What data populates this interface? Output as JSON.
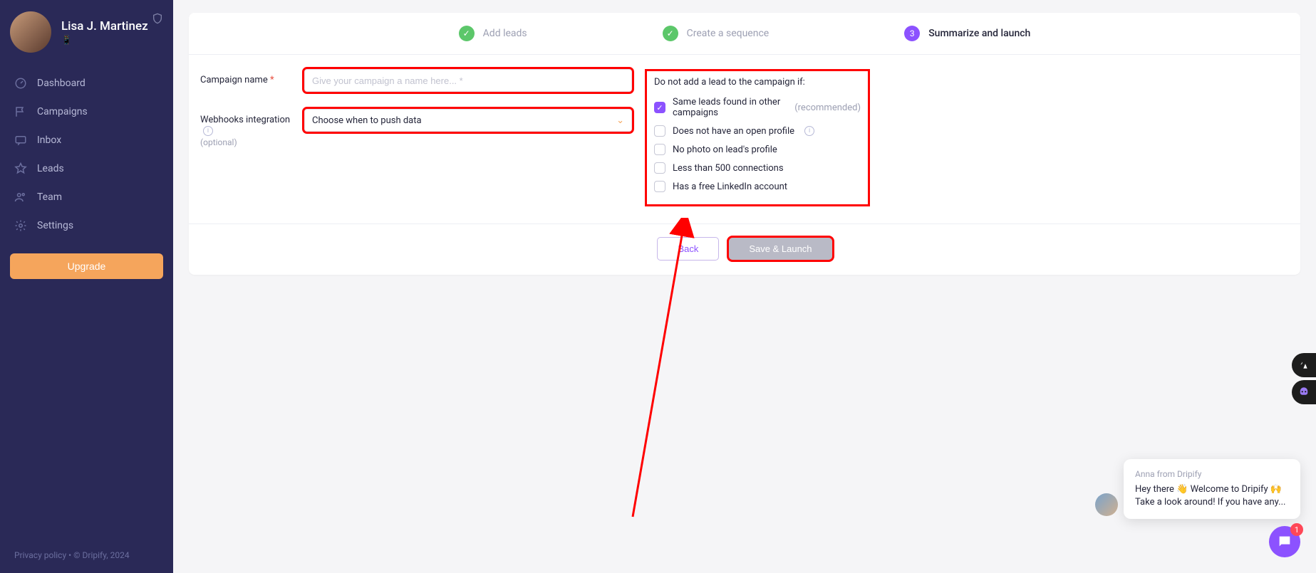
{
  "user": {
    "name": "Lisa J. Martinez",
    "subtitle": "📱"
  },
  "sidebar": {
    "nav": [
      {
        "label": "Dashboard"
      },
      {
        "label": "Campaigns"
      },
      {
        "label": "Inbox"
      },
      {
        "label": "Leads"
      },
      {
        "label": "Team"
      },
      {
        "label": "Settings"
      }
    ],
    "upgrade": "Upgrade",
    "footer_privacy": "Privacy policy",
    "footer_sep": "  •  ",
    "footer_copy": "© Dripify, 2024"
  },
  "stepper": {
    "step1": "Add leads",
    "step2": "Create a sequence",
    "step3_num": "3",
    "step3": "Summarize and launch"
  },
  "form": {
    "campaign_name_label": "Campaign name",
    "campaign_name_placeholder": "Give your campaign a name here... *",
    "webhooks_label": "Webhooks integration",
    "webhooks_optional": "(optional)",
    "webhooks_selected": "Choose when to push data"
  },
  "filters": {
    "title": "Do not add a lead to the campaign if:",
    "items": [
      {
        "label": "Same leads found in other campaigns",
        "rec": "(recommended)",
        "checked": true,
        "info": false
      },
      {
        "label": "Does not have an open profile",
        "rec": "",
        "checked": false,
        "info": true
      },
      {
        "label": "No photo on lead's profile",
        "rec": "",
        "checked": false,
        "info": false
      },
      {
        "label": "Less than 500 connections",
        "rec": "",
        "checked": false,
        "info": false
      },
      {
        "label": "Has a free LinkedIn account",
        "rec": "",
        "checked": false,
        "info": false
      }
    ]
  },
  "actions": {
    "back": "Back",
    "save_launch": "Save & Launch"
  },
  "chat": {
    "from": "Anna from Dripify",
    "msg": "Hey there 👋 Welcome to Dripify 🙌 Take a look around! If you have any...",
    "badge": "1"
  }
}
